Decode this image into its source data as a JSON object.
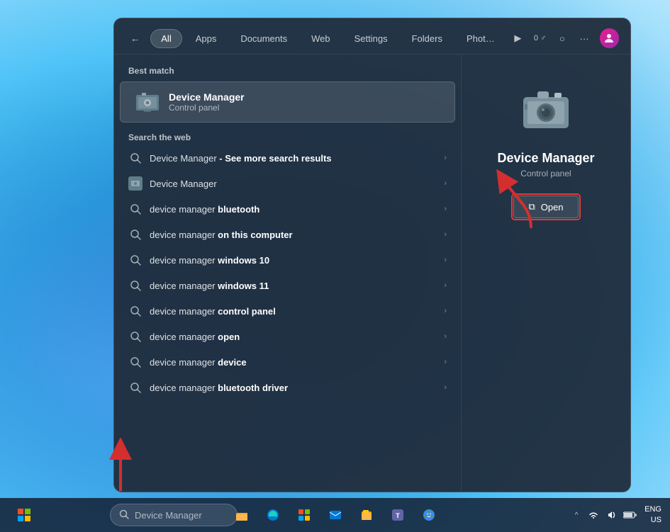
{
  "wallpaper": {
    "description": "Windows 11 blue wallpaper"
  },
  "searchPopup": {
    "navBack": "←",
    "tabs": [
      {
        "id": "all",
        "label": "All",
        "active": true
      },
      {
        "id": "apps",
        "label": "Apps",
        "active": false
      },
      {
        "id": "documents",
        "label": "Documents",
        "active": false
      },
      {
        "id": "web",
        "label": "Web",
        "active": false
      },
      {
        "id": "settings",
        "label": "Settings",
        "active": false
      },
      {
        "id": "folders",
        "label": "Folders",
        "active": false
      },
      {
        "id": "photos",
        "label": "Phot…",
        "active": false
      }
    ],
    "extraIcons": [
      "▶",
      "0 ♂",
      "○",
      "···"
    ],
    "bestMatch": {
      "label": "Best match",
      "item": {
        "title": "Device Manager",
        "subtitle": "Control panel",
        "iconType": "app"
      }
    },
    "searchTheWeb": {
      "label": "Search the web",
      "results": [
        {
          "type": "search",
          "text": "Device Manager",
          "bold": "- See more search results",
          "hasBold": true,
          "boldAfter": false
        },
        {
          "type": "app",
          "text": "Device Manager",
          "hasBold": false
        },
        {
          "type": "search",
          "prefix": "device manager ",
          "bold": "bluetooth",
          "hasBold": true
        },
        {
          "type": "search",
          "prefix": "device manager ",
          "bold": "on this computer",
          "hasBold": true
        },
        {
          "type": "search",
          "prefix": "device manager ",
          "bold": "windows 10",
          "hasBold": true
        },
        {
          "type": "search",
          "prefix": "device manager ",
          "bold": "windows 11",
          "hasBold": true
        },
        {
          "type": "search",
          "prefix": "device manager ",
          "bold": "control panel",
          "hasBold": true
        },
        {
          "type": "search",
          "prefix": "device manager ",
          "bold": "open",
          "hasBold": true
        },
        {
          "type": "search",
          "prefix": "device manager ",
          "bold": "device",
          "hasBold": true
        },
        {
          "type": "search",
          "prefix": "device manager ",
          "bold": "bluetooth driver",
          "hasBold": true
        }
      ]
    },
    "rightPanel": {
      "appName": "Device Manager",
      "appSub": "Control panel",
      "openButton": "Open",
      "openIcon": "⧉"
    }
  },
  "taskbar": {
    "searchPlaceholder": "Device Manager",
    "startIcon": "⊞",
    "searchIcon": "🔍",
    "tray": {
      "chevron": "^",
      "time": "ENG",
      "locale": "US",
      "wifi": "WiFi",
      "volume": "🔊",
      "battery": "🔋"
    }
  }
}
